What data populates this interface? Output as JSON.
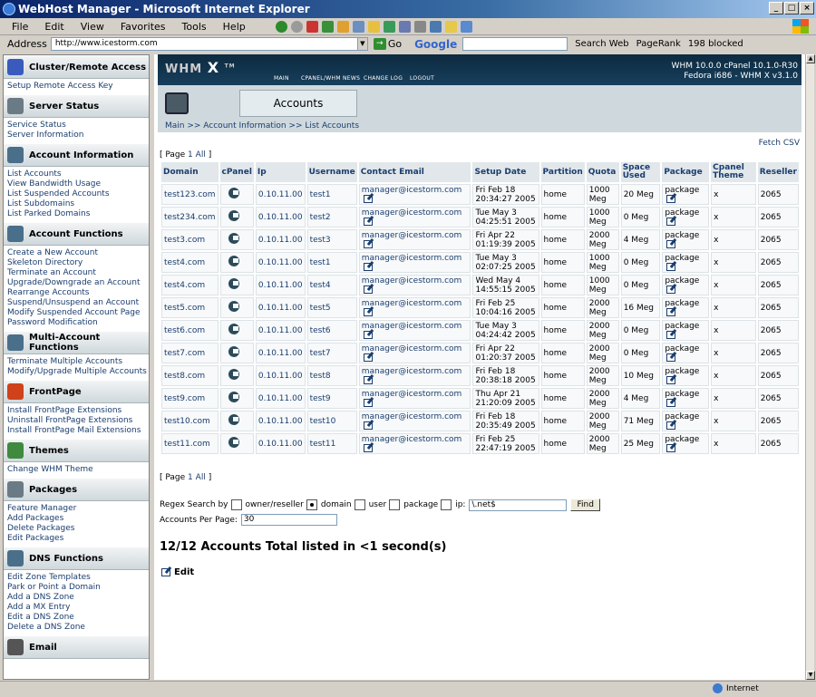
{
  "window": {
    "title": "WebHost Manager - Microsoft Internet Explorer"
  },
  "menu": [
    "File",
    "Edit",
    "View",
    "Favorites",
    "Tools",
    "Help"
  ],
  "toolbar": {
    "address_label": "Address",
    "address_value": "http://www.icestorm.com",
    "go_label": "Go",
    "google_label": "Google",
    "search_web_label": "Search Web",
    "pagerank_label": "PageRank",
    "blocked_label": "198 blocked"
  },
  "sidebar": {
    "sections": [
      {
        "title": "Cluster/Remote Access",
        "icon": "network-icon",
        "color": "#3a5bbd",
        "items": [
          "Setup Remote Access Key"
        ]
      },
      {
        "title": "Server Status",
        "icon": "server-icon",
        "color": "#6b7b86",
        "items": [
          "Service Status",
          "Server Information"
        ]
      },
      {
        "title": "Account Information",
        "icon": "user-info-icon",
        "color": "#4a6f8a",
        "items": [
          "List Accounts",
          "View Bandwidth Usage",
          "List Suspended Accounts",
          "List Subdomains",
          "List Parked Domains"
        ]
      },
      {
        "title": "Account Functions",
        "icon": "account-functions-icon",
        "color": "#4a6f8a",
        "items": [
          "Create a New Account",
          "Skeleton Directory",
          "Terminate an Account",
          "Upgrade/Downgrade an Account",
          "Rearrange Accounts",
          "Suspend/Unsuspend an Account",
          "Modify Suspended Account Page",
          "Password Modification"
        ]
      },
      {
        "title": "Multi-Account Functions",
        "icon": "multi-account-icon",
        "color": "#4a6f8a",
        "items": [
          "Terminate Multiple Accounts",
          "Modify/Upgrade Multiple Accounts"
        ]
      },
      {
        "title": "FrontPage",
        "icon": "frontpage-icon",
        "color": "#d0421b",
        "items": [
          "Install FrontPage Extensions",
          "Uninstall FrontPage Extensions",
          "Install FrontPage Mail Extensions"
        ]
      },
      {
        "title": "Themes",
        "icon": "themes-icon",
        "color": "#3f8a3f",
        "items": [
          "Change WHM Theme"
        ]
      },
      {
        "title": "Packages",
        "icon": "packages-icon",
        "color": "#6b7b86",
        "items": [
          "Feature Manager",
          "Add Packages",
          "Delete Packages",
          "Edit Packages"
        ]
      },
      {
        "title": "DNS Functions",
        "icon": "dns-icon",
        "color": "#4a6f8a",
        "items": [
          "Edit Zone Templates",
          "Park or Point a Domain",
          "Add a DNS Zone",
          "Add a MX Entry",
          "Edit a DNS Zone",
          "Delete a DNS Zone"
        ]
      },
      {
        "title": "Email",
        "icon": "email-icon",
        "color": "#555555",
        "items": []
      }
    ]
  },
  "header": {
    "logo": "WHM",
    "logo_x": "X",
    "logo_tm": "TM",
    "nav": [
      "MAIN",
      "CPANEL/WHM NEWS",
      "CHANGE LOG",
      "LOGOUT"
    ],
    "version_line1": "WHM 10.0.0 cPanel 10.1.0-R30",
    "version_line2": "Fedora i686 - WHM X v3.1.0"
  },
  "page": {
    "title": "Accounts",
    "breadcrumb": "Main >> Account Information >> List Accounts",
    "fetch_csv": "Fetch CSV",
    "pager_prefix": "[ Page",
    "pager_page": "1",
    "pager_all": "All",
    "pager_suffix": "]",
    "regex_label": "Regex Search by",
    "radio_options": [
      "owner/reseller",
      "domain",
      "user",
      "package",
      "ip:"
    ],
    "regex_value": "\\.net$",
    "find_label": "Find",
    "per_page_label": "Accounts Per Page:",
    "per_page_value": "30",
    "total_text": "12/12 Accounts Total listed in <1 second(s)",
    "edit_label": "Edit"
  },
  "table": {
    "headers": [
      "Domain",
      "cPanel",
      "Ip",
      "Username",
      "Contact Email",
      "Setup Date",
      "Partition",
      "Quota",
      "Space Used",
      "Package",
      "Cpanel Theme",
      "Reseller"
    ],
    "rows": [
      {
        "domain": "test123.com",
        "ip": "0.10.11.00",
        "user": "test1",
        "email": "manager@icestorm.com",
        "date1": "Fri Feb 18",
        "date2": "20:34:27 2005",
        "partition": "home",
        "quota": "1000 Meg",
        "used": "20 Meg",
        "package": "package",
        "theme": "x",
        "reseller": "2065"
      },
      {
        "domain": "test234.com",
        "ip": "0.10.11.00",
        "user": "test2",
        "email": "manager@icestorm.com",
        "date1": "Tue May 3",
        "date2": "04:25:51 2005",
        "partition": "home",
        "quota": "1000 Meg",
        "used": "0 Meg",
        "package": "package",
        "theme": "x",
        "reseller": "2065"
      },
      {
        "domain": "test3.com",
        "ip": "0.10.11.00",
        "user": "test3",
        "email": "manager@icestorm.com",
        "date1": "Fri Apr 22",
        "date2": "01:19:39 2005",
        "partition": "home",
        "quota": "2000 Meg",
        "used": "4 Meg",
        "package": "package",
        "theme": "x",
        "reseller": "2065"
      },
      {
        "domain": "test4.com",
        "ip": "0.10.11.00",
        "user": "test1",
        "email": "manager@icestorm.com",
        "date1": "Tue May 3",
        "date2": "02:07:25 2005",
        "partition": "home",
        "quota": "1000 Meg",
        "used": "0 Meg",
        "package": "package",
        "theme": "x",
        "reseller": "2065"
      },
      {
        "domain": "test4.com",
        "ip": "0.10.11.00",
        "user": "test4",
        "email": "manager@icestorm.com",
        "date1": "Wed May 4",
        "date2": "14:55:15 2005",
        "partition": "home",
        "quota": "1000 Meg",
        "used": "0 Meg",
        "package": "package",
        "theme": "x",
        "reseller": "2065"
      },
      {
        "domain": "test5.com",
        "ip": "0.10.11.00",
        "user": "test5",
        "email": "manager@icestorm.com",
        "date1": "Fri Feb 25",
        "date2": "10:04:16 2005",
        "partition": "home",
        "quota": "2000 Meg",
        "used": "16 Meg",
        "package": "package",
        "theme": "x",
        "reseller": "2065"
      },
      {
        "domain": "test6.com",
        "ip": "0.10.11.00",
        "user": "test6",
        "email": "manager@icestorm.com",
        "date1": "Tue May 3",
        "date2": "04:24:42 2005",
        "partition": "home",
        "quota": "2000 Meg",
        "used": "0 Meg",
        "package": "package",
        "theme": "x",
        "reseller": "2065"
      },
      {
        "domain": "test7.com",
        "ip": "0.10.11.00",
        "user": "test7",
        "email": "manager@icestorm.com",
        "date1": "Fri Apr 22",
        "date2": "01:20:37 2005",
        "partition": "home",
        "quota": "2000 Meg",
        "used": "0 Meg",
        "package": "package",
        "theme": "x",
        "reseller": "2065"
      },
      {
        "domain": "test8.com",
        "ip": "0.10.11.00",
        "user": "test8",
        "email": "manager@icestorm.com",
        "date1": "Fri Feb 18",
        "date2": "20:38:18 2005",
        "partition": "home",
        "quota": "2000 Meg",
        "used": "10 Meg",
        "package": "package",
        "theme": "x",
        "reseller": "2065"
      },
      {
        "domain": "test9.com",
        "ip": "0.10.11.00",
        "user": "test9",
        "email": "manager@icestorm.com",
        "date1": "Thu Apr 21",
        "date2": "21:20:09 2005",
        "partition": "home",
        "quota": "2000 Meg",
        "used": "4 Meg",
        "package": "package",
        "theme": "x",
        "reseller": "2065"
      },
      {
        "domain": "test10.com",
        "ip": "0.10.11.00",
        "user": "test10",
        "email": "manager@icestorm.com",
        "date1": "Fri Feb 18",
        "date2": "20:35:49 2005",
        "partition": "home",
        "quota": "2000 Meg",
        "used": "71 Meg",
        "package": "package",
        "theme": "x",
        "reseller": "2065"
      },
      {
        "domain": "test11.com",
        "ip": "0.10.11.00",
        "user": "test11",
        "email": "manager@icestorm.com",
        "date1": "Fri Feb 25",
        "date2": "22:47:19 2005",
        "partition": "home",
        "quota": "2000 Meg",
        "used": "25 Meg",
        "package": "package",
        "theme": "x",
        "reseller": "2065"
      }
    ]
  },
  "status": {
    "zone": "Internet"
  }
}
